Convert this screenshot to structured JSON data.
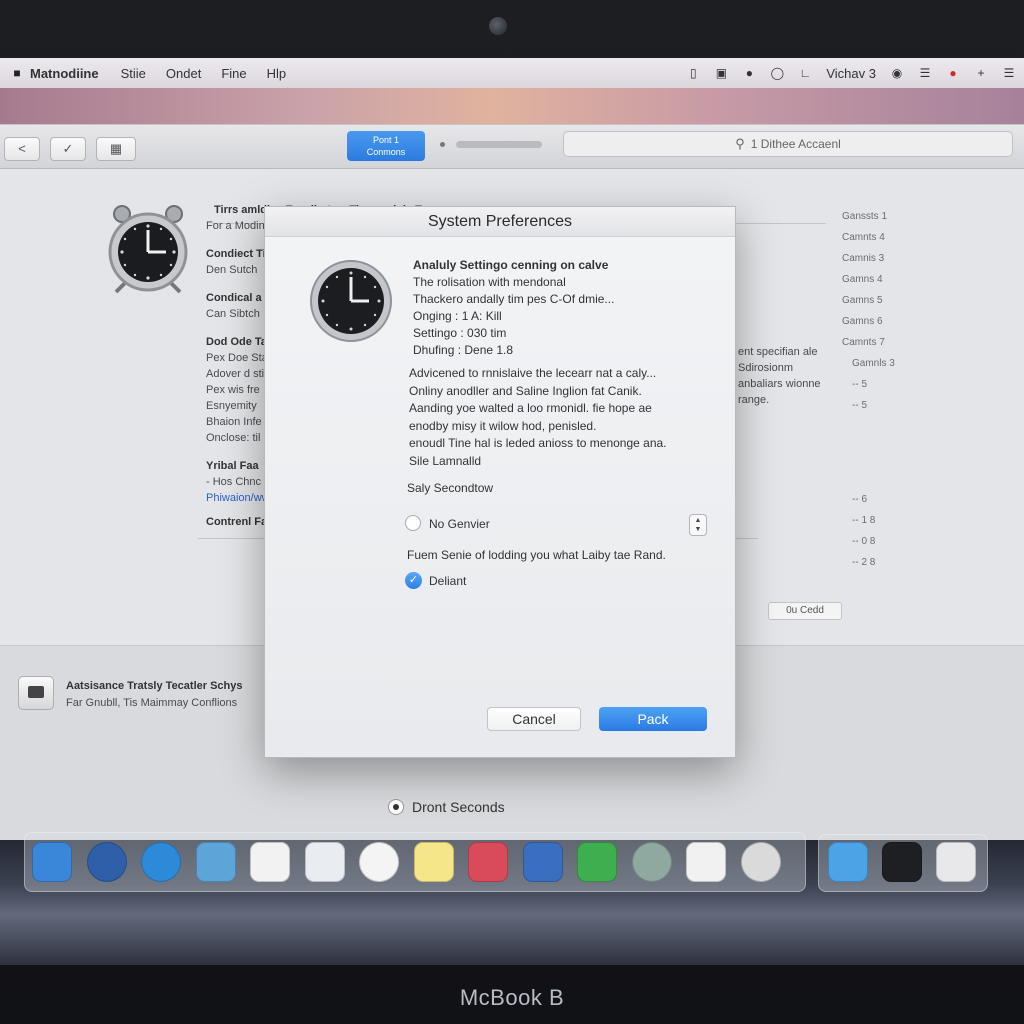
{
  "device": {
    "brand": "McBook B"
  },
  "menubar": {
    "apple_icon": "apple-icon",
    "items": [
      "Matnodiine",
      "Stiie",
      "Ondet",
      "Fine",
      "Hlp"
    ],
    "status_text": "Vichav 3"
  },
  "toolbar": {
    "back_label": "<",
    "seg_line1": "Pont 1",
    "seg_line2": "Conmons",
    "search_text": "1 Dithee Accaenl"
  },
  "background": {
    "heading": "Tirrs amldiny Tapaliert ay Tirer anduly Tane",
    "lines": [
      {
        "text": "For a Modiner",
        "bold": false
      },
      {
        "text": "Condiect Tin",
        "bold": true
      },
      {
        "text": "Den Sutch",
        "bold": false
      },
      {
        "text": "Condical a",
        "bold": true
      },
      {
        "text": "Can Sibtch",
        "bold": false
      },
      {
        "text": "Dod Ode Tac",
        "bold": true
      },
      {
        "text": "Pex Doe Stal",
        "bold": false
      },
      {
        "text": "Adover d sti",
        "bold": false
      },
      {
        "text": "Pex wis fre",
        "bold": false
      },
      {
        "text": "Esnyemity",
        "bold": false
      },
      {
        "text": "Bhaion Infe",
        "bold": false
      },
      {
        "text": "Onclose: til",
        "bold": false
      },
      {
        "text": "Yribal Faa",
        "bold": true
      },
      {
        "text": "-  Hos  Chnc",
        "bold": false
      },
      {
        "text": "Phiwaion/ww",
        "bold": false,
        "link": true
      },
      {
        "text": "Contrenl Fai",
        "bold": true
      }
    ],
    "right_notes": [
      "ent specifian ale",
      "Sdirosionm",
      "anbaliars wionne",
      "range."
    ],
    "right_numbers": [
      "Ganssts 1",
      "Camnts 4",
      "Camnis 3",
      "Gamns 4",
      "Gamns 5",
      "Gamns 6",
      "Camnts 7",
      "Gamnls 3",
      "-- 5",
      "-- 5",
      "-- 6",
      "-- 1 8",
      "-- 0 8",
      "-- 2 8"
    ],
    "pill": "0u Cedd",
    "drive_title": "Aatsisance Tratsly Tecatler Schys",
    "drive_sub": "Far Gnubll, Tis Maimmay Conflions"
  },
  "dialog": {
    "title": "System Preferences",
    "info": [
      "Analuly Settingo cenning on calve",
      "The rolisation with mendonal",
      "Thackero andally tim pes C-Of dmie...",
      "Onging : 1 A: Kill",
      "Settingo : 030 tim",
      "Dhufing : Dene 1.8"
    ],
    "description": [
      "Advicened to rnnislaive the lecearr nat a caly...",
      "Onliny anodller and Saline Inglion fat Canik.",
      "Aanding yoe walted a loo rmonidl. fie hope ae",
      "enodby misy it wilow hod, penisled.",
      "enoudl Tine hal is leded anioss to menonge ana.",
      "Sile Lamnalld"
    ],
    "section_label": "Saly Secondtow",
    "radio_label": "No Genvier",
    "note": "Fuem Senie of lodding you what Laiby tae Rand.",
    "checkbox_label": "Deliant",
    "cancel_label": "Cancel",
    "primary_label": "Pack"
  },
  "bottom_radio_label": "Dront Seconds",
  "dock": {
    "apps": [
      {
        "name": "finder-icon",
        "color": "#3a86d8"
      },
      {
        "name": "network-icon",
        "color": "#2f5fa8"
      },
      {
        "name": "safari-icon",
        "color": "#2d8ad9"
      },
      {
        "name": "migration-icon",
        "color": "#5da5d8"
      },
      {
        "name": "calendar-icon",
        "color": "#f2f2f2"
      },
      {
        "name": "preview-icon",
        "color": "#e9edf2"
      },
      {
        "name": "photos-icon",
        "color": "#f4f4f4"
      },
      {
        "name": "notes-icon",
        "color": "#f6e68a"
      },
      {
        "name": "photo-booth-icon",
        "color": "#d94a5a"
      },
      {
        "name": "app-store-icon",
        "color": "#3a6fbf"
      },
      {
        "name": "messages-icon",
        "color": "#3fae4e"
      },
      {
        "name": "alien-icon",
        "color": "#8fa9a0"
      },
      {
        "name": "textedit-icon",
        "color": "#f1f1f1"
      },
      {
        "name": "clock-icon",
        "color": "#dadada"
      }
    ],
    "right": [
      {
        "name": "folder-icon",
        "color": "#4aa4e6"
      },
      {
        "name": "terminal-icon",
        "color": "#1e1f23"
      },
      {
        "name": "trash-icon",
        "color": "#e8e8ea"
      }
    ]
  }
}
